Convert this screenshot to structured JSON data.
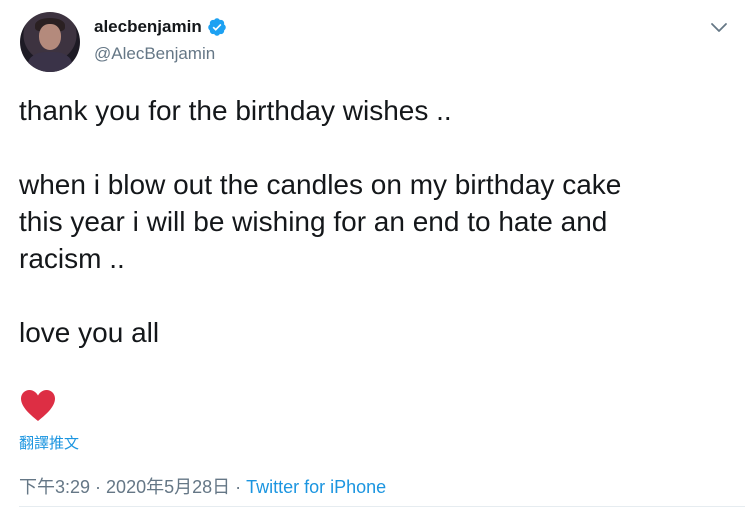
{
  "user": {
    "display_name": "alecbenjamin",
    "handle": "@AlecBenjamin",
    "verified": true
  },
  "tweet": {
    "line1": "thank you for the birthday wishes ..",
    "line2": "when i blow out the candles on my birthday cake",
    "line3": "this year i will be wishing for an end to hate and",
    "line4": "racism ..",
    "line5": "love you all"
  },
  "emoji": "heart-emoji",
  "translate_label": "翻譯推文",
  "meta": {
    "time": "下午3:29",
    "separator": " · ",
    "date": "2020年5月28日",
    "source": "Twitter for iPhone"
  },
  "colors": {
    "link": "#1b95e0",
    "secondary": "#657786",
    "heart": "#e0245e",
    "verified": "#1da1f2"
  },
  "icons": {
    "verified": "verified-badge-icon",
    "chevron": "chevron-down-icon"
  }
}
